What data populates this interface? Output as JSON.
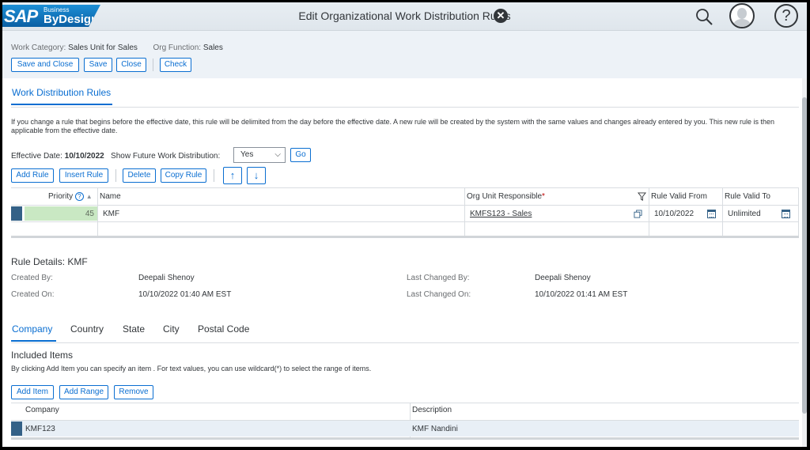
{
  "shell": {
    "logo_sap": "SAP",
    "logo_business": "Business",
    "logo_bydesign": "ByDesign",
    "title": "Edit Organizational Work Distribution Rules",
    "close_glyph": "✕",
    "help_glyph": "?"
  },
  "header": {
    "work_category_label": "Work Category:",
    "work_category_value": "Sales Unit for Sales",
    "org_function_label": "Org Function:",
    "org_function_value": "Sales"
  },
  "toolbar": {
    "save_and_close": "Save and Close",
    "save": "Save",
    "close": "Close",
    "check": "Check"
  },
  "section": {
    "tab": "Work Distribution Rules",
    "info": "If you change a rule that begins before the effective date, this rule will be delimited from the day before the effective date. A new rule will be created by the system with the same values and changes already entered by you. This new rule is then applicable from the effective date."
  },
  "filter": {
    "effective_date_label": "Effective Date:",
    "effective_date_value": "10/10/2022",
    "show_future_label": "Show Future Work Distribution:",
    "show_future_value": "Yes",
    "go": "Go"
  },
  "rule_toolbar": {
    "add_rule": "Add Rule",
    "insert_rule": "Insert Rule",
    "delete": "Delete",
    "copy_rule": "Copy Rule",
    "move_up": "↑",
    "move_down": "↓"
  },
  "rules_table": {
    "headers": {
      "priority": "Priority",
      "name": "Name",
      "org_unit": "Org Unit Responsible",
      "required_mark": "*",
      "valid_from": "Rule Valid From",
      "valid_to": "Rule Valid To"
    },
    "rows": [
      {
        "priority": "45",
        "name": "KMF",
        "org_unit": "KMFS123 - Sales",
        "valid_from": "10/10/2022",
        "valid_to": "Unlimited"
      }
    ]
  },
  "details": {
    "title": "Rule Details: KMF",
    "created_by_label": "Created By:",
    "created_by": "Deepali Shenoy",
    "created_on_label": "Created On:",
    "created_on": "10/10/2022 01:40 AM EST",
    "last_changed_by_label": "Last Changed By:",
    "last_changed_by": "Deepali Shenoy",
    "last_changed_on_label": "Last Changed On:",
    "last_changed_on": "10/10/2022 01:41 AM EST"
  },
  "tabs": [
    "Company",
    "Country",
    "State",
    "City",
    "Postal Code"
  ],
  "included": {
    "title": "Included Items",
    "info": "By clicking Add Item you can specify an item . For text values, you can use wildcard(*) to select the range of items.",
    "add_item": "Add Item",
    "add_range": "Add Range",
    "remove": "Remove",
    "headers": {
      "company": "Company",
      "description": "Description"
    },
    "rows": [
      {
        "company": "KMF123",
        "description": "KMF Nandini"
      }
    ]
  },
  "colors": {
    "accent": "#0a6ed1",
    "priority_fill": "#c9e8c3",
    "row_marker": "#346187"
  }
}
